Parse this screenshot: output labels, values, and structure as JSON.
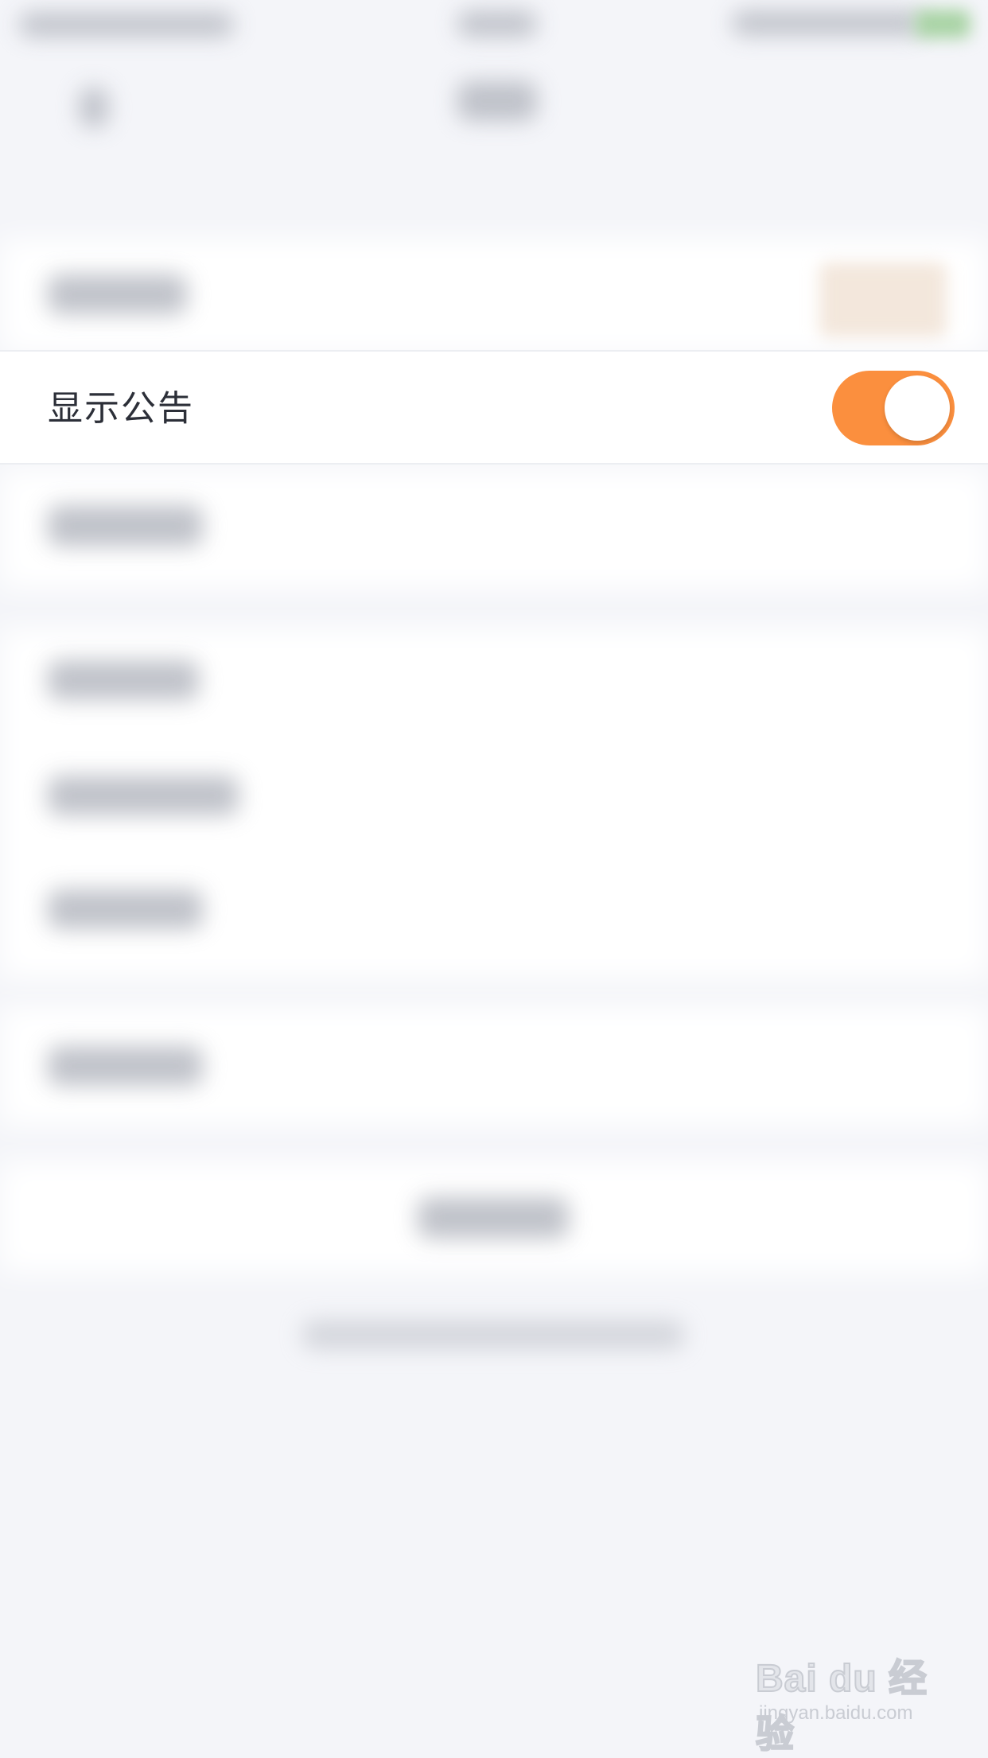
{
  "settings": {
    "announcement_label": "显示公告",
    "announcement_toggle": "on"
  },
  "watermark": {
    "logo_text": "Bai du 经验",
    "domain_text": "jingyan.baidu.com"
  },
  "colors": {
    "accent": "#fb8f3e",
    "background": "#f4f5f9",
    "row_bg": "#ffffff",
    "label_text": "#2c2f38"
  }
}
